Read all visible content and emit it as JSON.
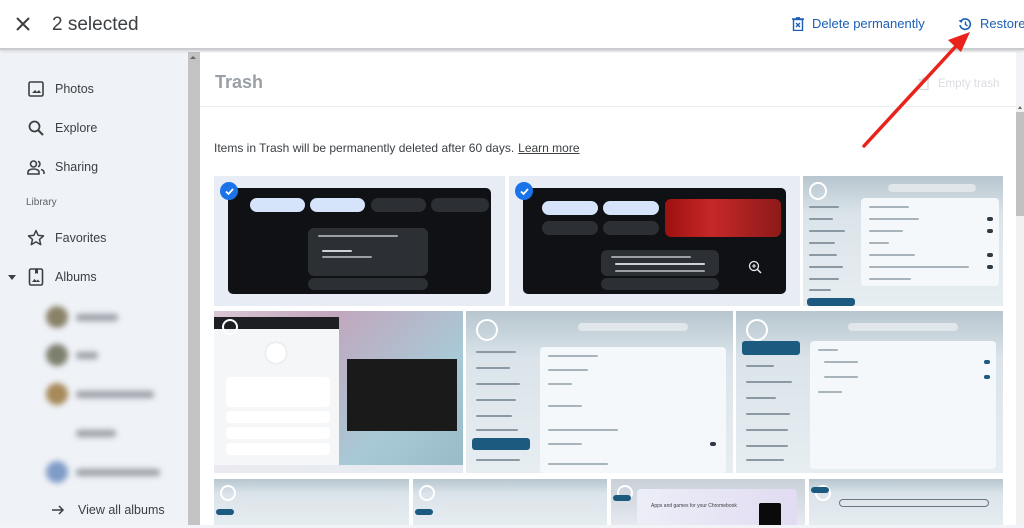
{
  "topbar": {
    "selected_label": "2 selected",
    "delete_label": "Delete permanently",
    "restore_label": "Restore",
    "accent_color": "#1a5fb4"
  },
  "sidebar": {
    "items": [
      {
        "label": "Photos",
        "icon": "photo-icon"
      },
      {
        "label": "Explore",
        "icon": "search-icon"
      },
      {
        "label": "Sharing",
        "icon": "people-icon"
      }
    ],
    "library_label": "Library",
    "library_items": [
      {
        "label": "Favorites",
        "icon": "star-icon"
      },
      {
        "label": "Albums",
        "icon": "album-icon",
        "expanded": true
      }
    ],
    "albums_blurred": [
      {
        "color": "#8a8268"
      },
      {
        "color": "#7d7f6e"
      },
      {
        "color": "#a7895a"
      },
      {
        "color": ""
      },
      {
        "color": "#7f9cc7"
      }
    ],
    "view_all_label": "View all albums"
  },
  "main": {
    "title": "Trash",
    "empty_trash_label": "Empty trash",
    "info_text": "Items in Trash will be permanently deleted after 60 days.",
    "learn_more_label": "Learn more"
  },
  "photos": [
    {
      "id": 1,
      "kind": "quick-settings",
      "selected": true
    },
    {
      "id": 2,
      "kind": "quick-settings-media",
      "selected": true
    },
    {
      "id": 3,
      "kind": "settings-accessibility",
      "selected": false
    },
    {
      "id": 4,
      "kind": "desktop-spotify",
      "selected": false
    },
    {
      "id": 5,
      "kind": "settings-system-preferences",
      "selected": false
    },
    {
      "id": 6,
      "kind": "settings-network",
      "selected": false
    },
    {
      "id": 7,
      "kind": "play-store",
      "selected": false
    },
    {
      "id": 8,
      "kind": "play-store",
      "selected": false
    },
    {
      "id": 9,
      "kind": "play-store-banner",
      "selected": false,
      "banner_text": "Apps and games for your Chromebook"
    },
    {
      "id": 10,
      "kind": "play-store",
      "selected": false
    }
  ],
  "annotation": {
    "arrow_color": "#e8231c",
    "points_to": "Restore"
  }
}
